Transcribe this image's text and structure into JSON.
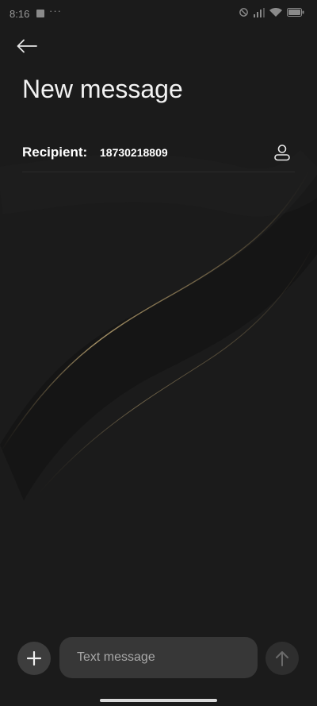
{
  "status_bar": {
    "time": "8:16",
    "notification_dots": "···",
    "icons": [
      "notification-square-icon",
      "alarm-icon",
      "signal-icon",
      "wifi-icon",
      "battery-icon"
    ]
  },
  "header": {
    "back_icon": "arrow-left-icon",
    "title": "New message"
  },
  "recipient": {
    "label": "Recipient:",
    "value": "18730218809",
    "contact_icon": "person-icon"
  },
  "composer": {
    "attach_icon": "plus-icon",
    "placeholder": "Text message",
    "value": "",
    "send_icon": "arrow-up-icon"
  },
  "colors": {
    "background": "#1a1a1a",
    "accent_gold": "#b8a070",
    "input_bg": "#373737"
  }
}
